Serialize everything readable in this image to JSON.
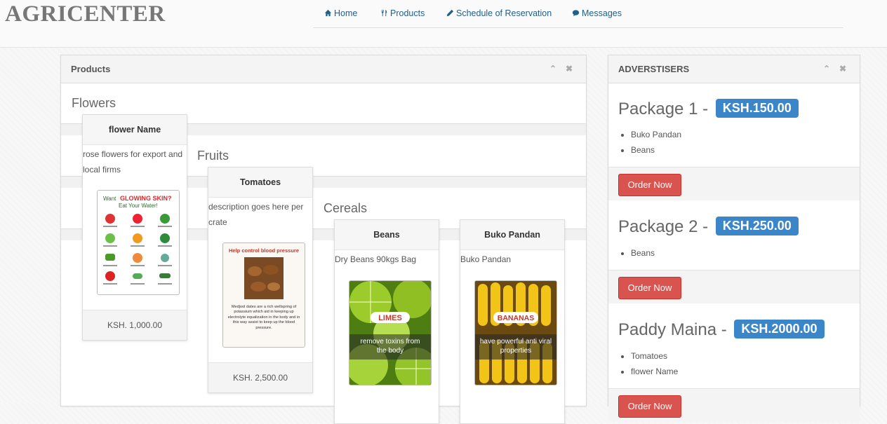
{
  "brand": "AGRICENTER",
  "nav": [
    {
      "label": "Home",
      "icon": "home-icon"
    },
    {
      "label": "Products",
      "icon": "cutlery-icon"
    },
    {
      "label": "Schedule of Reservation",
      "icon": "pencil-icon"
    },
    {
      "label": "Messages",
      "icon": "comment-icon"
    }
  ],
  "products_panel": {
    "title": "Products",
    "categories": [
      "Flowers",
      "Fruits",
      "Cereals"
    ],
    "cards": [
      {
        "name": "flower Name",
        "desc": "rose flowers for export and local firms",
        "price": "KSH. 1,000.00",
        "image_text": [
          "Want",
          "GLOWING SKIN?",
          "Eat Your Water!"
        ]
      },
      {
        "name": "Tomatoes",
        "desc": "description goes here per crate",
        "price": "KSH. 2,500.00",
        "image_text": [
          "Help control blood pressure",
          "Medjool dates are a rich wellspring of potassium which aid in keeping up electrolyte equalization in the body and in this way assist to keep up the blood pressure."
        ]
      },
      {
        "name": "Beans",
        "desc": "Dry Beans 90kgs Bag",
        "image_text": [
          "LIMES",
          "remove toxins from the body"
        ]
      },
      {
        "name": "Buko Pandan",
        "desc": "Buko Pandan",
        "image_text": [
          "BANANAS",
          "have powerful anti viral properties"
        ]
      }
    ]
  },
  "advertisers_panel": {
    "title": "ADVERSTISERS",
    "order_label": "Order Now",
    "packages": [
      {
        "name": "Package 1 -",
        "price": "KSH.150.00",
        "items": [
          "Buko Pandan",
          "Beans"
        ]
      },
      {
        "name": "Package 2 -",
        "price": "KSH.250.00",
        "items": [
          "Beans"
        ]
      },
      {
        "name": "Paddy Maina -",
        "price": "KSH.2000.00",
        "items": [
          "Tomatoes",
          "flower Name"
        ]
      }
    ]
  },
  "colors": {
    "accent": "#3a86c8",
    "danger": "#d9534f",
    "link": "#1f5f8c"
  }
}
